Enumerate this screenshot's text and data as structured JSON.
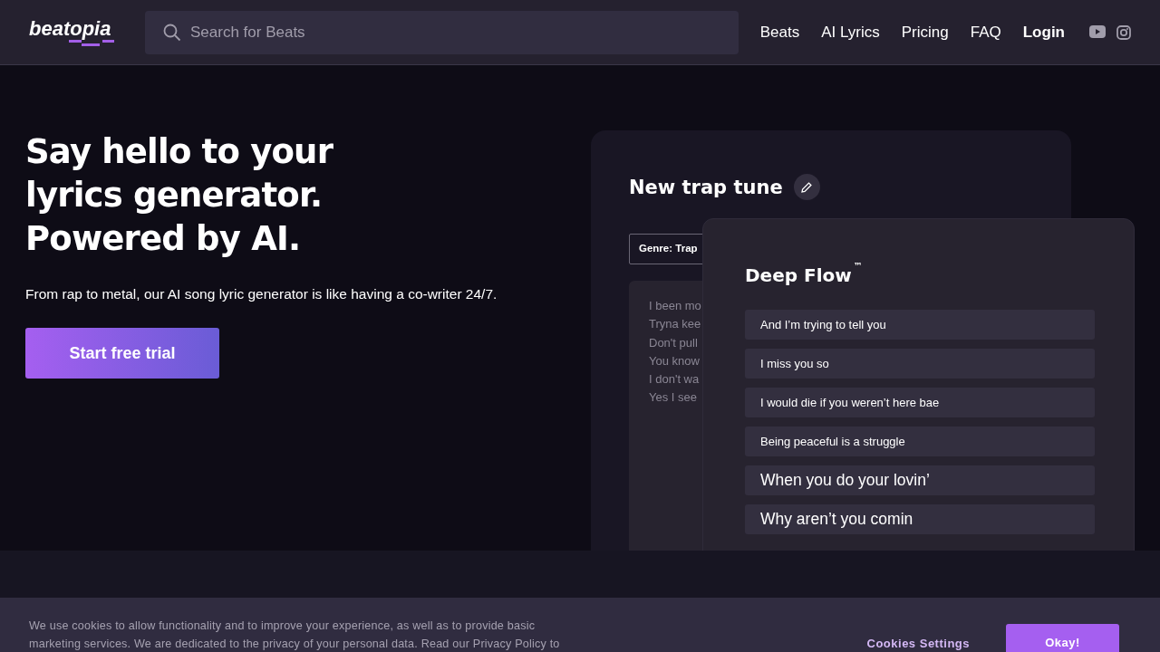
{
  "header": {
    "logo": "beatopia",
    "search": {
      "placeholder": "Search for Beats"
    },
    "nav": [
      {
        "label": "Beats",
        "kind": "link"
      },
      {
        "label": "AI Lyrics",
        "kind": "link"
      },
      {
        "label": "Pricing",
        "kind": "link"
      },
      {
        "label": "FAQ",
        "kind": "link"
      },
      {
        "label": "Login",
        "kind": "login"
      }
    ]
  },
  "hero": {
    "heading_lines": [
      "Say hello to your",
      "lyrics generator.",
      "Powered by AI."
    ],
    "subtitle": "From rap to metal, our AI song lyric generator is like having a co-writer 24/7.",
    "cta": "Start free trial"
  },
  "mockup": {
    "title": "New trap tune",
    "genre": "Genre: Trap",
    "draft_lines": [
      "I been mo",
      "Tryna kee",
      "Don't pull",
      "You know",
      "I don't wa",
      "Yes I see"
    ],
    "card_title": "Deep Flow",
    "card_mark": "™",
    "suggestions": [
      {
        "text": "And I’m trying to tell you",
        "kind": "small"
      },
      {
        "text": "I miss you so",
        "kind": "small"
      },
      {
        "text": "I would die if you weren’t here bae",
        "kind": "small"
      },
      {
        "text": "Being peaceful is a struggle",
        "kind": "small"
      },
      {
        "text": "When you do your lovin’",
        "kind": "large"
      },
      {
        "text": "Why aren’t you comin",
        "kind": "large"
      }
    ]
  },
  "cookie_banner": {
    "text": "We use cookies to allow functionality and to improve your experience, as well as to provide basic marketing services. We are dedicated to the privacy of your personal data. Read our Privacy Policy to",
    "buttons": [
      {
        "label": "Cookies Settings",
        "kind": "secondary"
      },
      {
        "label": "Okay!",
        "kind": "primary"
      }
    ]
  }
}
